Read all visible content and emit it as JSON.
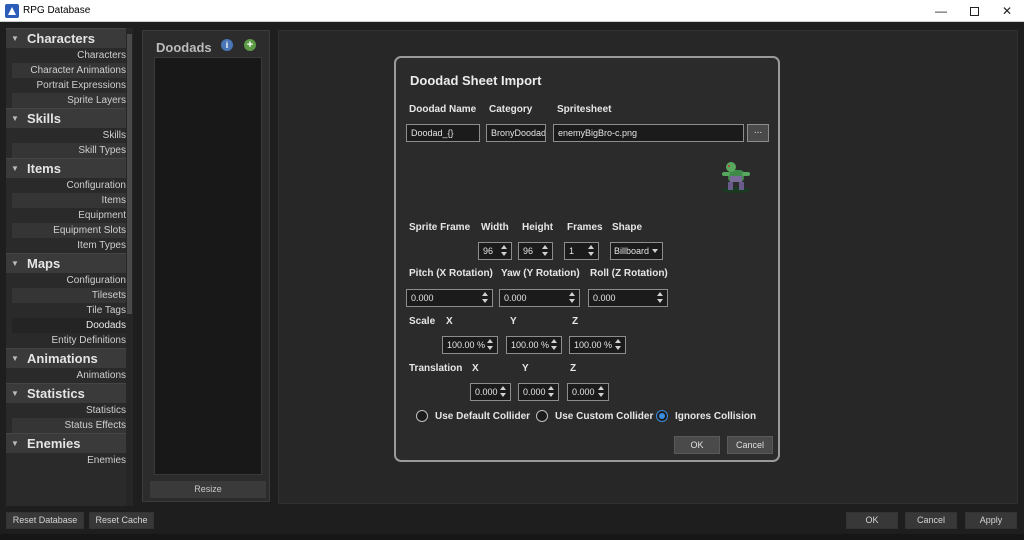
{
  "window": {
    "title": "RPG Database",
    "minimize_glyph": "—",
    "close_glyph": "✕"
  },
  "sidebar": {
    "groups": [
      {
        "title": "Characters",
        "items": [
          "Characters",
          "Character Animations",
          "Portrait Expressions",
          "Sprite Layers"
        ]
      },
      {
        "title": "Skills",
        "items": [
          "Skills",
          "Skill Types"
        ]
      },
      {
        "title": "Items",
        "items": [
          "Configuration",
          "Items",
          "Equipment",
          "Equipment Slots",
          "Item Types"
        ]
      },
      {
        "title": "Maps",
        "items": [
          "Configuration",
          "Tilesets",
          "Tile Tags",
          "Doodads",
          "Entity Definitions"
        ]
      },
      {
        "title": "Animations",
        "items": [
          "Animations"
        ]
      },
      {
        "title": "Statistics",
        "items": [
          "Statistics",
          "Status Effects"
        ]
      },
      {
        "title": "Enemies",
        "items": [
          "Enemies"
        ]
      }
    ],
    "selected_item": "Doodads"
  },
  "doodad_panel": {
    "title": "Doodads",
    "info_glyph": "i",
    "add_glyph": "+",
    "resize_label": "Resize"
  },
  "dialog": {
    "title": "Doodad Sheet Import",
    "doodad_name_label": "Doodad Name",
    "category_label": "Category",
    "spritesheet_label": "Spritesheet",
    "doodad_name_value": "Doodad_{}",
    "category_value": "BronyDoodad",
    "spritesheet_value": "enemyBigBro-c.png",
    "browse_label": "...",
    "sprite_frame_label": "Sprite Frame",
    "width_label": "Width",
    "height_label": "Height",
    "frames_label": "Frames",
    "shape_label": "Shape",
    "width_value": "96",
    "height_value": "96",
    "frames_value": "1",
    "shape_value": "Billboard",
    "pitch_label": "Pitch (X Rotation)",
    "yaw_label": "Yaw (Y Rotation)",
    "roll_label": "Roll (Z Rotation)",
    "pitch_value": "0.000",
    "yaw_value": "0.000",
    "roll_value": "0.000",
    "scale_label": "Scale",
    "x_label": "X",
    "y_label": "Y",
    "z_label": "Z",
    "scale_x": "100.00 %",
    "scale_y": "100.00 %",
    "scale_z": "100.00 %",
    "translation_label": "Translation",
    "trans_x": "0.000",
    "trans_y": "0.000",
    "trans_z": "0.000",
    "collider_options": [
      "Use Default Collider",
      "Use Custom Collider",
      "Ignores Collision"
    ],
    "selected_collider": "Ignores Collision",
    "ok_label": "OK",
    "cancel_label": "Cancel"
  },
  "bottom": {
    "reset_database": "Reset Database",
    "reset_cache": "Reset Cache",
    "ok": "OK",
    "cancel": "Cancel",
    "apply": "Apply"
  },
  "colors": {
    "accent": "#3d8ee0",
    "background": "#1e1e1e"
  }
}
